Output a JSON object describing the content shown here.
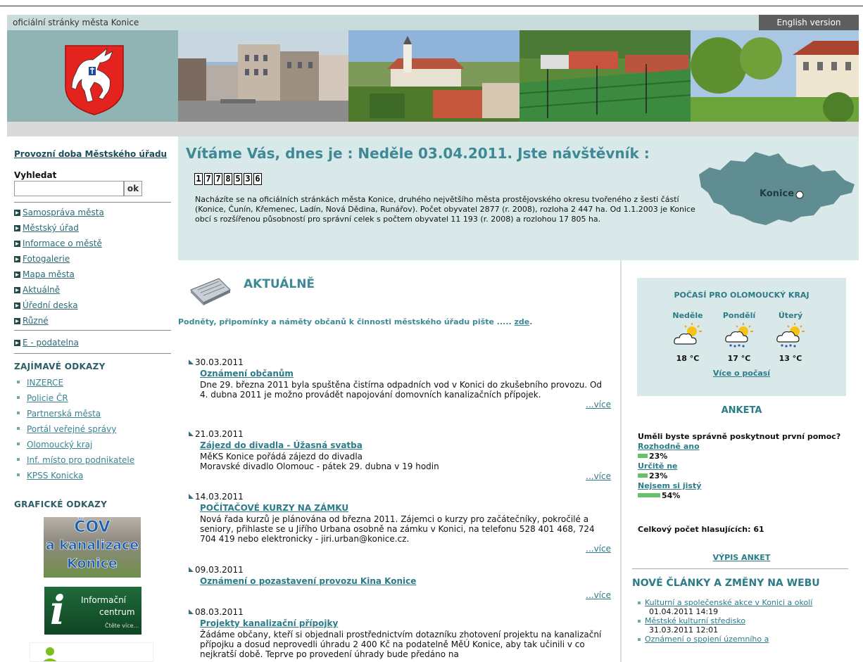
{
  "header": {
    "tagline": "oficiální stránky města Konice",
    "english_link": "English version"
  },
  "sidebar": {
    "office_hours_link": "Provozní doba Městského úřadu",
    "search_label": "Vyhledat",
    "search_value": "",
    "search_button": "ok",
    "menu": [
      {
        "label": "Samospráva města"
      },
      {
        "label": "Městský úřad"
      },
      {
        "label": "Informace o městě"
      },
      {
        "label": "Fotogalerie"
      },
      {
        "label": "Mapa města"
      },
      {
        "label": "Aktuálně"
      },
      {
        "label": "Úřední deska"
      },
      {
        "label": "Různé"
      }
    ],
    "epodatelna": "E - podatelna",
    "interesting_heading": "ZAJÍMAVÉ ODKAZY",
    "links": [
      {
        "label": "INZERCE"
      },
      {
        "label": "Policie ČR"
      },
      {
        "label": "Partnerská města"
      },
      {
        "label": "Portál veřejné správy"
      },
      {
        "label": "Olomoucký kraj"
      },
      {
        "label": "Inf. místo pro podnikatele"
      },
      {
        "label": "KPSS Konicka"
      }
    ],
    "graphic_heading": "GRAFICKÉ ODKAZY",
    "banner_cov": {
      "line1": "ČOV",
      "line2": "a kanalizace",
      "line3": "Konice"
    },
    "banner_info": {
      "line1": "Informační",
      "line2": "centrum",
      "line3": "Čtěte více..."
    }
  },
  "welcome": {
    "title": "Vítáme Vás, dnes je : Neděle 03.04.2011. Jste návštěvník :",
    "counter": [
      "1",
      "7",
      "7",
      "8",
      "5",
      "3",
      "6"
    ],
    "text": "Nacházíte se na oficiálních stránkách města Konice, druhého největšího města prostějovského okresu tvořeného z šesti částí (Konice, Čunín, Křemenec, Ladín, Nová Dědina, Runářov). Počet obyvatel 2877 (r. 2008), rozloha 2 447 ha. Od 1.1.2003 je Konice obcí s rozšířenou působností pro správní celek s počtem obyvatel 11 193 (r. 2008) a rozlohou 17 805 ha.",
    "map_label": "Konice"
  },
  "main": {
    "heading": "AKTUÁLNĚ",
    "notice_text": "Podněty, připomínky a náměty občanů k činnosti městského úřadu  pište .....",
    "notice_link": "zde",
    "notice_end": ".",
    "more_label": "...více",
    "news": [
      {
        "date": "30.03.2011",
        "title": "Oznámení občanům",
        "body": "Dne 29. března 2011 byla spuštěna čistírna odpadních vod v Konici do zkušebního provozu. Od 4. dubna 2011 je možno provádět napojování domovních kanalizačních přípojek."
      },
      {
        "date": "21.03.2011",
        "title": "Zájezd do divadla - Úžasná svatba",
        "body": "MěKS Konice pořádá zájezd do divadla\nMoravské divadlo Olomouc - pátek 29. dubna v 19 hodin"
      },
      {
        "date": "14.03.2011",
        "title": "POČÍTAČOVÉ KURZY NA ZÁMKU",
        "body": "Nová řada kurzů je plánována od března 2011. Zájemci o kurzy pro začátečníky, pokročilé a seniory, přihlaste se u Jiřího Urbana osobně na zámku v Konici, na telefonu 528 401 468, 724 704 419 nebo elektronicky - jiri.urban@konice.cz."
      },
      {
        "date": "09.03.2011",
        "title": "Oznámení o pozastavení provozu Kina Konice",
        "body": ""
      },
      {
        "date": "08.03.2011",
        "title": "Projekty kanalizační přípojky",
        "body": "Žádáme občany, kteří si objednali prostřednictvím dotazníku zhotovení projektu na kanalizační přípojku a dosud neprovedli úhradu 2 400 Kč na podatelně MěÚ Konice, aby tak učinili v co nejkratší době. Teprve po provedení úhrady bude předáno na"
      }
    ]
  },
  "weather": {
    "title": "POČASÍ PRO OLOMOUCKÝ KRAJ",
    "days": [
      {
        "day": "Neděle",
        "temp": "18 °C",
        "icon": "partly-cloudy-icon"
      },
      {
        "day": "Pondělí",
        "temp": "17 °C",
        "icon": "rain-sun-icon"
      },
      {
        "day": "Úterý",
        "temp": "13 °C",
        "icon": "rain-sun-icon"
      }
    ],
    "more": "Více o počasí"
  },
  "poll": {
    "heading": "ANKETA",
    "question": "Uměli byste správně poskytnout první pomoc?",
    "options": [
      {
        "label": "Rozhodně ano",
        "result": "23%",
        "fraction": 0.23
      },
      {
        "label": "Určitě ne",
        "result": "23%",
        "fraction": 0.23
      },
      {
        "label": "Nejsem si jistý",
        "result": "54%",
        "fraction": 0.54
      }
    ],
    "votes": "Celkový počet hlasujících: 61",
    "list_link": "VÝPIS ANKET"
  },
  "new_articles": {
    "heading": "NOVÉ ČLÁNKY A ZMĚNY NA WEBU",
    "items": [
      {
        "title": "Kulturní a společenské akce v Konici a okolí",
        "date": "01.04.2011 14:19"
      },
      {
        "title": "Městské kulturní středisko",
        "date": "31.03.2011 12:01"
      },
      {
        "title": "Oznámení o spojení územního a",
        "date": ""
      }
    ]
  },
  "colors": {
    "accent": "#3d8a96",
    "light_panel": "#d9e8e8",
    "banner_bg": "#90b4b4",
    "poll_bar": "#67c167"
  }
}
